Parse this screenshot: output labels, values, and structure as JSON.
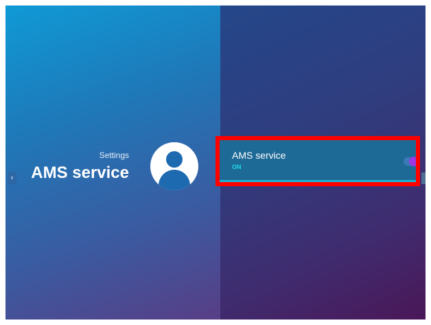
{
  "header": {
    "breadcrumb": "Settings",
    "title": "AMS service"
  },
  "nav": {
    "left_arrow": "›"
  },
  "setting": {
    "label": "AMS service",
    "status": "ON",
    "toggle_on": true
  },
  "colors": {
    "highlight": "#ff0000",
    "row_bg": "#1e6a97",
    "status_text": "#21d6e6",
    "toggle_thumb": "#9b37e3"
  }
}
